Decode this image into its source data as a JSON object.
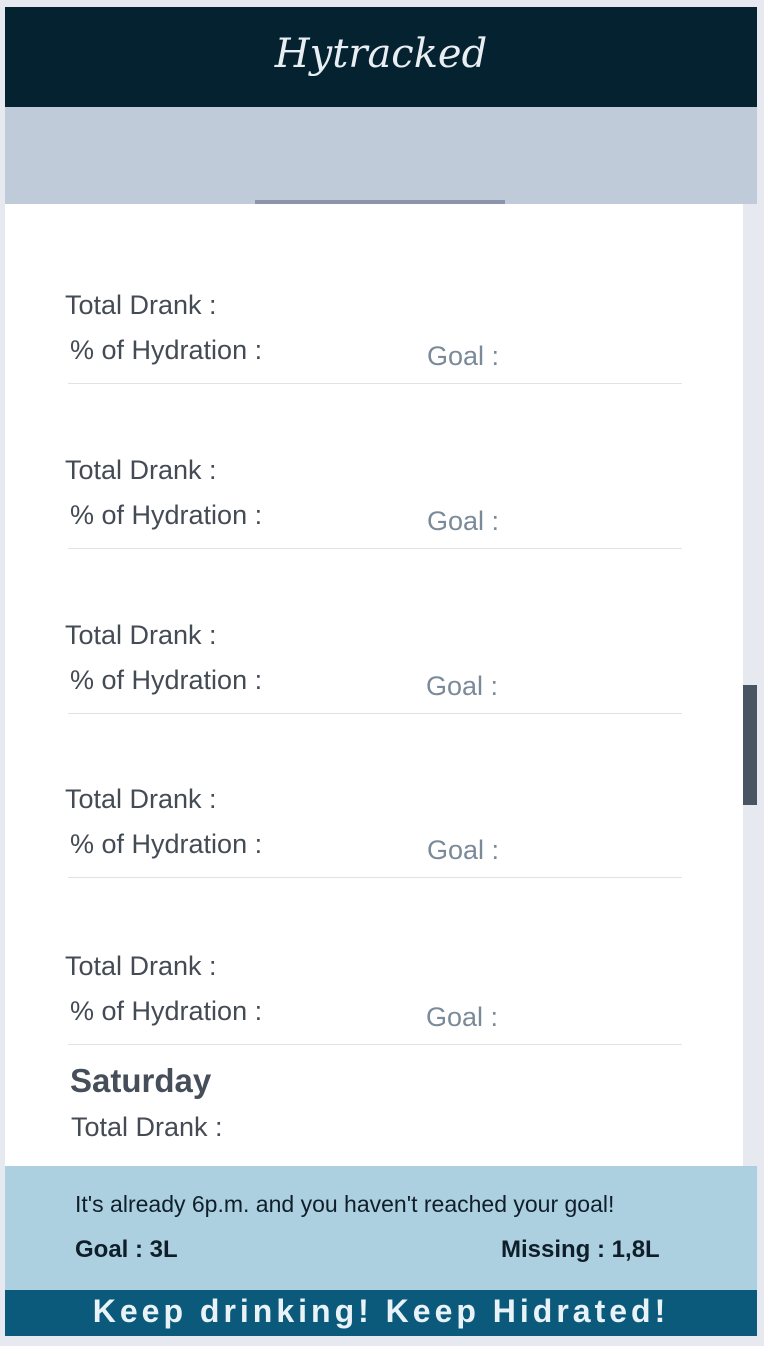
{
  "header": {
    "logo_text": "Hytracked"
  },
  "entries": [
    {
      "total_label": "Total Drank :",
      "hydration_label": "% of Hydration :",
      "goal_label": "Goal :"
    },
    {
      "total_label": "Total Drank :",
      "hydration_label": "% of Hydration :",
      "goal_label": "Goal :"
    },
    {
      "total_label": "Total Drank :",
      "hydration_label": "% of Hydration :",
      "goal_label": "Goal :"
    },
    {
      "total_label": "Total Drank :",
      "hydration_label": "% of Hydration :",
      "goal_label": "Goal :"
    },
    {
      "total_label": "Total Drank :",
      "hydration_label": "% of Hydration :",
      "goal_label": "Goal :"
    }
  ],
  "saturday": {
    "day": "Saturday",
    "total_label": "Total Drank :"
  },
  "alert": {
    "message": "It's already 6p.m. and you haven't reached your goal!",
    "goal": "Goal : 3L",
    "missing": "Missing : 1,8L"
  },
  "footer": {
    "slogan": "Keep drinking! Keep Hidrated!"
  },
  "colors": {
    "header_bg": "#052230",
    "tab_band": "#bfcbd9",
    "alert_bg": "#acd0e0",
    "footer_bg": "#0b5a7c"
  }
}
